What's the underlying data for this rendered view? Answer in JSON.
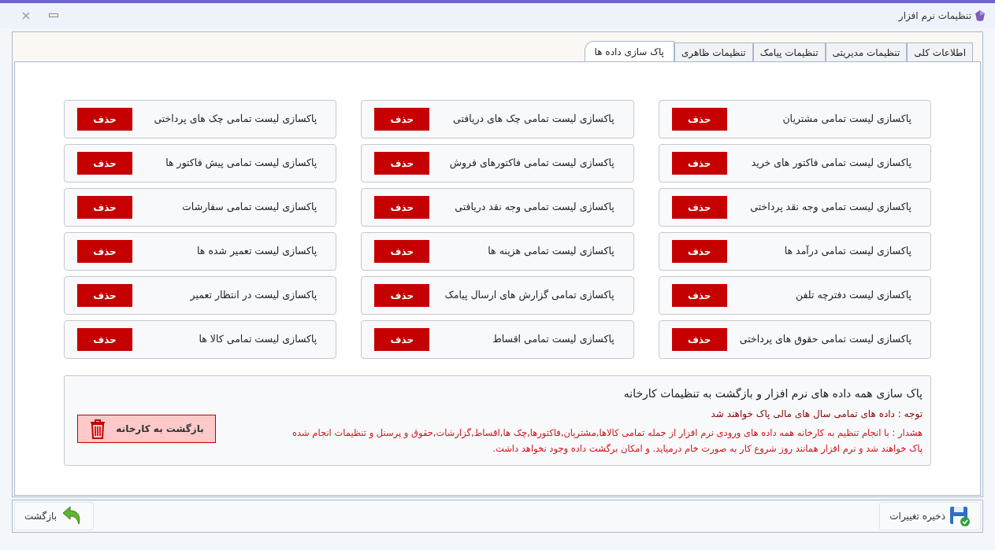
{
  "window": {
    "title": "تنظیمات نرم افزار"
  },
  "tabs": [
    {
      "label": "اطلاعات کلی",
      "selected": false
    },
    {
      "label": "تنظیمات مدیریتی",
      "selected": false
    },
    {
      "label": "تنظیمات پیامک",
      "selected": false
    },
    {
      "label": "تنظیمات ظاهری",
      "selected": false
    },
    {
      "label": "پاک سازی داده ها",
      "selected": true
    }
  ],
  "purge_items": [
    {
      "label": "پاکسازی لیست تمامی مشتریان",
      "button": "حذف"
    },
    {
      "label": "پاکسازی لیست تمامی چک های دریافتی",
      "button": "حذف"
    },
    {
      "label": "پاکسازی لیست تمامی چک های پرداختی",
      "button": "حذف"
    },
    {
      "label": "پاکسازی لیست تمامی فاکتور های خرید",
      "button": "حذف"
    },
    {
      "label": "پاکسازی لیست تمامی فاکتورهای فروش",
      "button": "حذف"
    },
    {
      "label": "پاکسازی لیست تمامی پیش فاکتور ها",
      "button": "حذف"
    },
    {
      "label": "پاکسازی لیست تمامی وجه نقد پرداختی",
      "button": "حذف"
    },
    {
      "label": "پاکسازی لیست تمامی وجه نقد دریافتی",
      "button": "حذف"
    },
    {
      "label": "پاکسازی لیست تمامی سفارشات",
      "button": "حذف"
    },
    {
      "label": "پاکسازی لیست تمامی درآمد ها",
      "button": "حذف"
    },
    {
      "label": "پاکسازی لیست تمامی هزینه ها",
      "button": "حذف"
    },
    {
      "label": "پاکسازی لیست تعمیر شده ها",
      "button": "حذف"
    },
    {
      "label": "پاکسازی لیست دفترچه تلفن",
      "button": "حذف"
    },
    {
      "label": "پاکسازی تمامی گزارش های ارسال پیامک",
      "button": "حذف"
    },
    {
      "label": "پاکسازی لیست در انتظار تعمیر",
      "button": "حذف"
    },
    {
      "label": "پاکسازی لیست تمامی حقوق های پرداختی",
      "button": "حذف"
    },
    {
      "label": "پاکسازی لیست تمامی اقساط",
      "button": "حذف"
    },
    {
      "label": "پاکسازی لیست تمامی کالا ها",
      "button": "حذف"
    }
  ],
  "factory_reset": {
    "heading": "پاک سازی همه داده های نرم افزار و بازگشت به تنظیمات کارخانه",
    "note": "توجه : داده های تمامی سال های مالی پاک خواهند شد",
    "warning": "هشدار : با انجام تنظیم به کارخانه همه داده های ورودی نرم افزار از جمله تمامی کالاها,مشتریان,فاکتورها,چک ها,اقساط,گزارشات,حقوق و پرسنل و تنظیمات انجام شده پاک خواهند شد و نرم افزار همانند روز شروع کار به صورت خام درمیاید. و امکان برگشت داده وجود نخواهد داشت.",
    "button": "بازگشت به کارخانه"
  },
  "footer": {
    "save_button": "ذخیره تغییرات",
    "back_button": "بازگشت"
  }
}
